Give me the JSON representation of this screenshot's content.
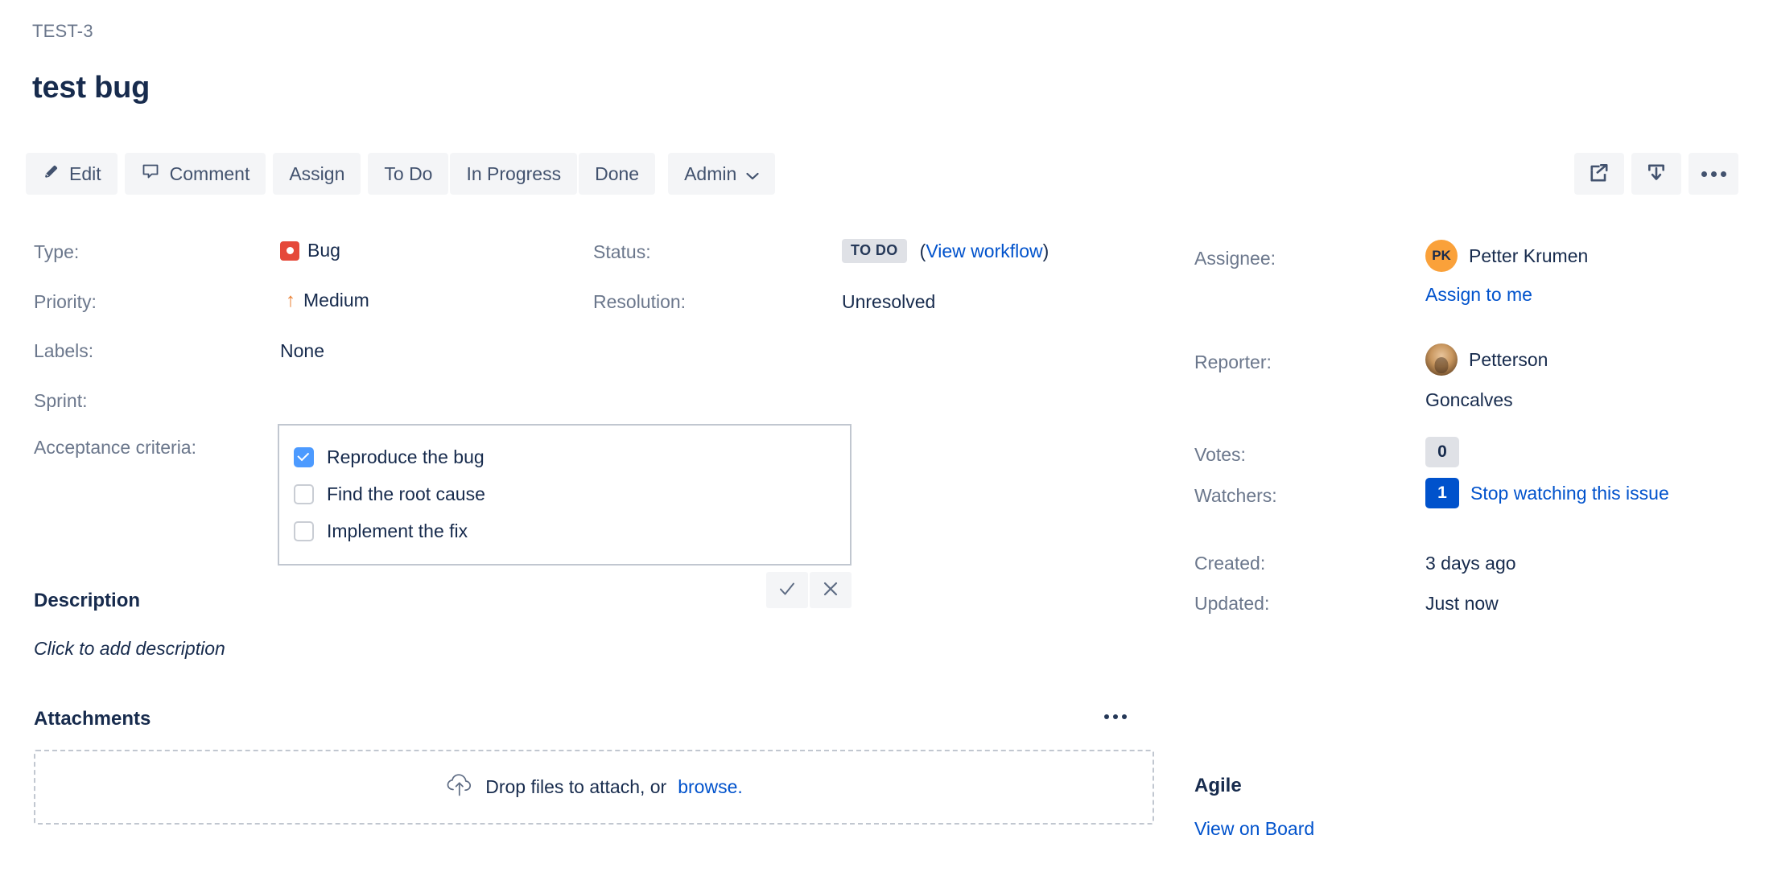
{
  "header": {
    "breadcrumb": "TEST-3",
    "title": "test bug"
  },
  "toolbar": {
    "edit": "Edit",
    "comment": "Comment",
    "assign": "Assign",
    "todo": "To Do",
    "in_progress": "In Progress",
    "done": "Done",
    "admin": "Admin",
    "admin_caret": "⌄"
  },
  "details": {
    "type_label": "Type:",
    "type_value": "Bug",
    "priority_label": "Priority:",
    "priority_value": "Medium",
    "priority_arrow": "↑",
    "labels_label": "Labels:",
    "labels_value": "None",
    "sprint_label": "Sprint:",
    "sprint_value": "",
    "status_label": "Status:",
    "status_value": "TO DO",
    "view_workflow_open": "(",
    "view_workflow": "View workflow",
    "view_workflow_close": ")",
    "resolution_label": "Resolution:",
    "resolution_value": "Unresolved",
    "acceptance_label": "Acceptance criteria:"
  },
  "acceptance_criteria": [
    {
      "label": "Reproduce the bug",
      "checked": true
    },
    {
      "label": "Find the root cause",
      "checked": false
    },
    {
      "label": "Implement the fix",
      "checked": false
    }
  ],
  "description": {
    "heading": "Description",
    "placeholder": "Click to add description"
  },
  "attachments": {
    "heading": "Attachments",
    "drop_text": "Drop files to attach, or",
    "browse": "browse.",
    "browse_suffix": ""
  },
  "sidebar": {
    "assignee_label": "Assignee:",
    "assignee_name": "Petter Krumen",
    "assignee_initials": "PK",
    "assign_to_me": "Assign to me",
    "reporter_label": "Reporter:",
    "reporter_name_line1": "Petterson",
    "reporter_name_line2": "Goncalves",
    "votes_label": "Votes:",
    "votes_value": "0",
    "watchers_label": "Watchers:",
    "watchers_value": "1",
    "stop_watching": "Stop watching this issue",
    "created_label": "Created:",
    "created_value": "3 days ago",
    "updated_label": "Updated:",
    "updated_value": "Just now",
    "agile_heading": "Agile",
    "view_on_board": "View on Board"
  },
  "colors": {
    "link": "#0052CC",
    "bug": "#E5493A",
    "priority": "#E97F33",
    "checkbox_checked": "#4C9AFF",
    "lozenge_bg": "#DFE1E6",
    "watcher_badge": "#0052CC",
    "avatar_pk": "#FAA13A",
    "toolbar_bg": "#F4F5F7",
    "text": "#172B4D",
    "muted": "#6B778C"
  }
}
